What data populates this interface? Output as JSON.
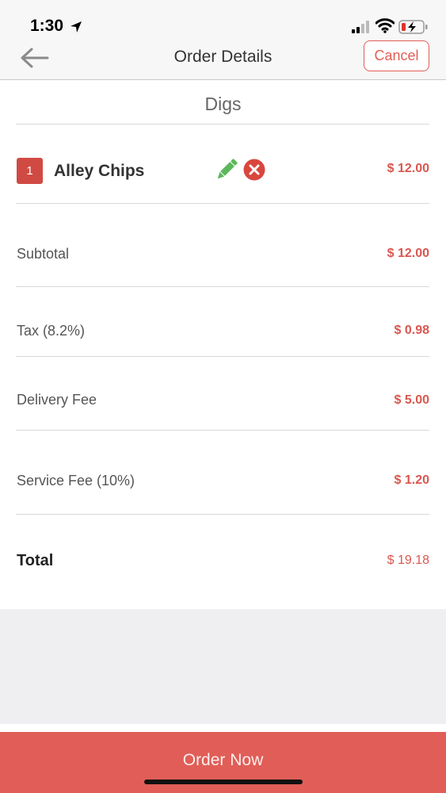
{
  "status_bar": {
    "time": "1:30"
  },
  "nav": {
    "title": "Order Details",
    "cancel_label": "Cancel"
  },
  "restaurant": {
    "name": "Digs"
  },
  "items": [
    {
      "quantity": "1",
      "name": "Alley Chips",
      "price": "$ 12.00"
    }
  ],
  "summary": {
    "subtotal_label": "Subtotal",
    "subtotal_value": "$ 12.00",
    "tax_label": "Tax (8.2%)",
    "tax_value": "$ 0.98",
    "delivery_label": "Delivery Fee",
    "delivery_value": "$ 5.00",
    "service_label": "Service Fee (10%)",
    "service_value": "$ 1.20",
    "total_label": "Total",
    "total_value": "$ 19.18"
  },
  "footer": {
    "order_label": "Order Now"
  },
  "icons": {
    "back": "arrow-left-icon",
    "edit": "pencil-icon",
    "remove": "close-circle-icon",
    "location": "location-arrow-icon",
    "signal": "cellular-signal-icon",
    "wifi": "wifi-icon",
    "battery": "battery-charging-icon"
  },
  "colors": {
    "accent": "#e05e57",
    "price": "#d9574f",
    "edit": "#5cb85c",
    "badge": "#d04a43"
  }
}
